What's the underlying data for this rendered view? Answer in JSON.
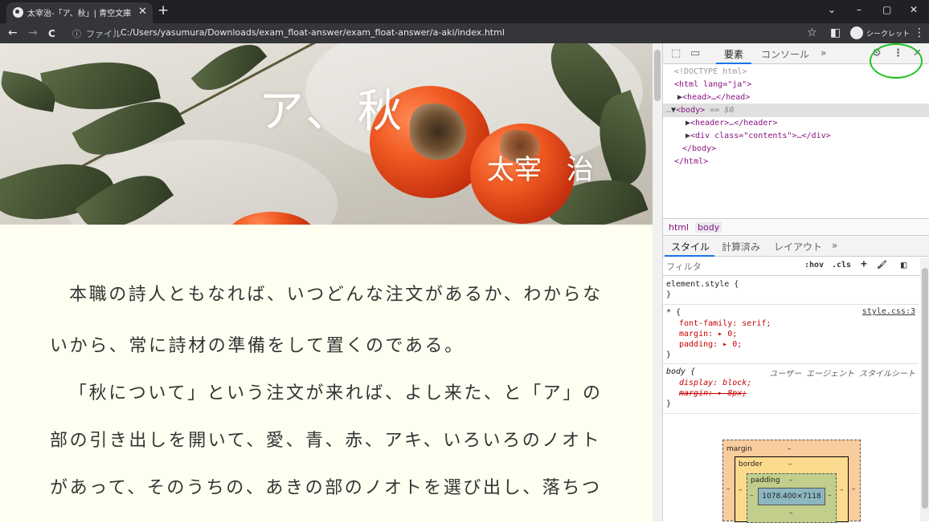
{
  "browser": {
    "tab_title": "太宰治-「ア、秋」| 青空文庫",
    "tab_close": "✕",
    "new_tab": "+",
    "window_controls": [
      "⌄",
      "–",
      "▢",
      "✕"
    ],
    "nav": {
      "back": "←",
      "forward": "→",
      "reload": "C"
    },
    "url_info": "ⓘ",
    "url_scheme": "ファイル",
    "url_separator": "|",
    "url": "C:/Users/yasumura/Downloads/exam_float-answer/exam_float-answer/a-aki/index.html",
    "bookmark": "☆",
    "side_panel": "◧",
    "incognito_label": "シークレット",
    "menu": "⋮"
  },
  "page": {
    "title": "ア、秋",
    "author": "太宰 治",
    "paragraphs": [
      "本職の詩人ともなれば、いつどんな注文があるか、わからな",
      "いから、常に詩材の準備をして置くのである。",
      "「秋について」という注文が来れば、よし来た、と「ア」の",
      "部の引き出しを開いて、愛、青、赤、アキ、いろいろのノオト",
      "があって、そのうちの、あきの部のノオトを選び出し、落ちつ"
    ]
  },
  "devtools": {
    "toolbar": {
      "inspect_icon": "⬚",
      "device_icon": "▭",
      "tabs": [
        "要素",
        "コンソール"
      ],
      "more": "»",
      "settings": "⚙",
      "menu": "⋮",
      "close": "✕"
    },
    "dom": {
      "doctype": "<!DOCTYPE html>",
      "html_open": "<html lang=\"ja\">",
      "head": "<head>…</head>",
      "body_prefix": "…",
      "body_open": "<body>",
      "body_eq": "== $0",
      "header": "<header>…</header>",
      "div_open": "<div class=\"contents\">…</div>",
      "body_close": "</body>",
      "html_close": "</html>"
    },
    "breadcrumbs": [
      "html",
      "body"
    ],
    "subtabs": [
      "スタイル",
      "計算済み",
      "レイアウト"
    ],
    "subtabs_more": "»",
    "filter_placeholder": "フィルタ",
    "filter_buttons": [
      ":hov",
      ".cls",
      "+",
      "🖌",
      "◧"
    ],
    "styles": {
      "element_style": "element.style {",
      "close": "}",
      "universal_selector": "* {",
      "universal_source": "style.css:3",
      "universal_props": [
        "font-family: serif;",
        "margin: ▸ 0;",
        "padding: ▸ 0;"
      ],
      "body_selector": "body {",
      "body_source": "ユーザー エージェント スタイルシート",
      "body_props": [
        "display: block;",
        "margin: ▸ 8px;"
      ]
    },
    "box_model": {
      "margin": "margin",
      "border": "border",
      "padding": "padding",
      "dash": "–",
      "content": "1078.400×7118"
    }
  }
}
